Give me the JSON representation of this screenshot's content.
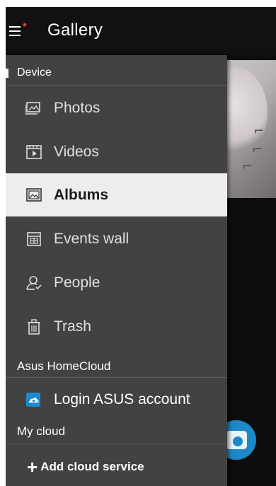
{
  "app": {
    "title": "Gallery"
  },
  "drawer": {
    "device_header": "Device",
    "items": [
      {
        "label": "Photos",
        "icon": "photos-icon"
      },
      {
        "label": "Videos",
        "icon": "videos-icon"
      },
      {
        "label": "Albums",
        "icon": "albums-icon",
        "selected": true
      },
      {
        "label": "Events wall",
        "icon": "events-wall-icon"
      },
      {
        "label": "People",
        "icon": "people-icon"
      },
      {
        "label": "Trash",
        "icon": "trash-icon"
      }
    ],
    "homecloud_header": "Asus HomeCloud",
    "login_label": "Login ASUS account",
    "mycloud_header": "My cloud",
    "add_cloud_label": "Add cloud service"
  },
  "colors": {
    "drawer_bg": "#424242",
    "selected_bg": "#ededed",
    "accent_blue": "#1e88d0",
    "notification_dot": "#e53935"
  }
}
